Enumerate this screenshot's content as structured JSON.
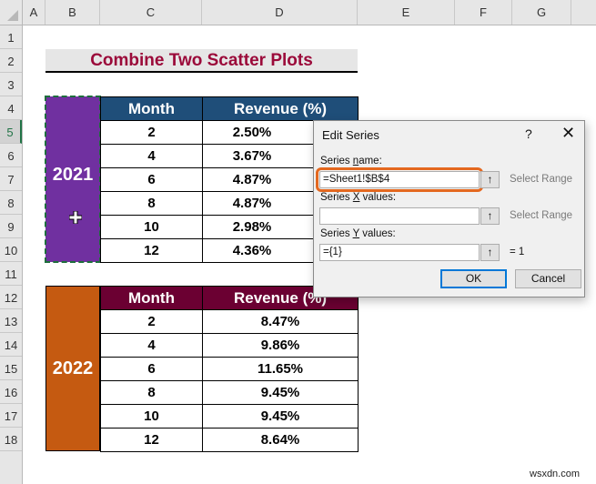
{
  "spreadsheet": {
    "columns": [
      "A",
      "B",
      "C",
      "D",
      "E",
      "F",
      "G"
    ],
    "rows": [
      "1",
      "2",
      "3",
      "4",
      "5",
      "6",
      "7",
      "8",
      "9",
      "10",
      "11",
      "12",
      "13",
      "14",
      "15",
      "16",
      "17",
      "18"
    ],
    "active_row": "5",
    "title": "Combine Two Scatter Plots",
    "table_2021": {
      "year": "2021",
      "headers": [
        "Month",
        "Revenue (%)"
      ],
      "rows": [
        {
          "month": "2",
          "revenue": "2.50%"
        },
        {
          "month": "4",
          "revenue": "3.67%"
        },
        {
          "month": "6",
          "revenue": "4.87%"
        },
        {
          "month": "8",
          "revenue": "4.87%"
        },
        {
          "month": "10",
          "revenue": "2.98%"
        },
        {
          "month": "12",
          "revenue": "4.36%"
        }
      ],
      "year_color": "#7030a0",
      "header_color": "#1f4e79"
    },
    "table_2022": {
      "year": "2022",
      "headers": [
        "Month",
        "Revenue (%)"
      ],
      "rows": [
        {
          "month": "2",
          "revenue": "8.47%"
        },
        {
          "month": "4",
          "revenue": "9.86%"
        },
        {
          "month": "6",
          "revenue": "11.65%"
        },
        {
          "month": "8",
          "revenue": "9.45%"
        },
        {
          "month": "10",
          "revenue": "9.45%"
        },
        {
          "month": "12",
          "revenue": "8.64%"
        }
      ],
      "year_color": "#c55a11",
      "header_color": "#6b0032"
    }
  },
  "dialog": {
    "title": "Edit Series",
    "help": "?",
    "close": "✕",
    "series_name_label_pre": "Series ",
    "series_name_label_u": "n",
    "series_name_label_post": "ame:",
    "series_name_value": "=Sheet1!$B$4",
    "series_x_label_pre": "Series ",
    "series_x_label_u": "X",
    "series_x_label_post": " values:",
    "series_x_value": "",
    "series_y_label_pre": "Series ",
    "series_y_label_u": "Y",
    "series_y_label_post": " values:",
    "series_y_value": "={1}",
    "range_button_icon": "↑",
    "select_range_1": "Select Range",
    "select_range_2": "Select Range",
    "y_result": "=  1",
    "ok_label": "OK",
    "cancel_label": "Cancel",
    "highlight_color": "#e4681f"
  },
  "watermark": "wsxdn.com"
}
